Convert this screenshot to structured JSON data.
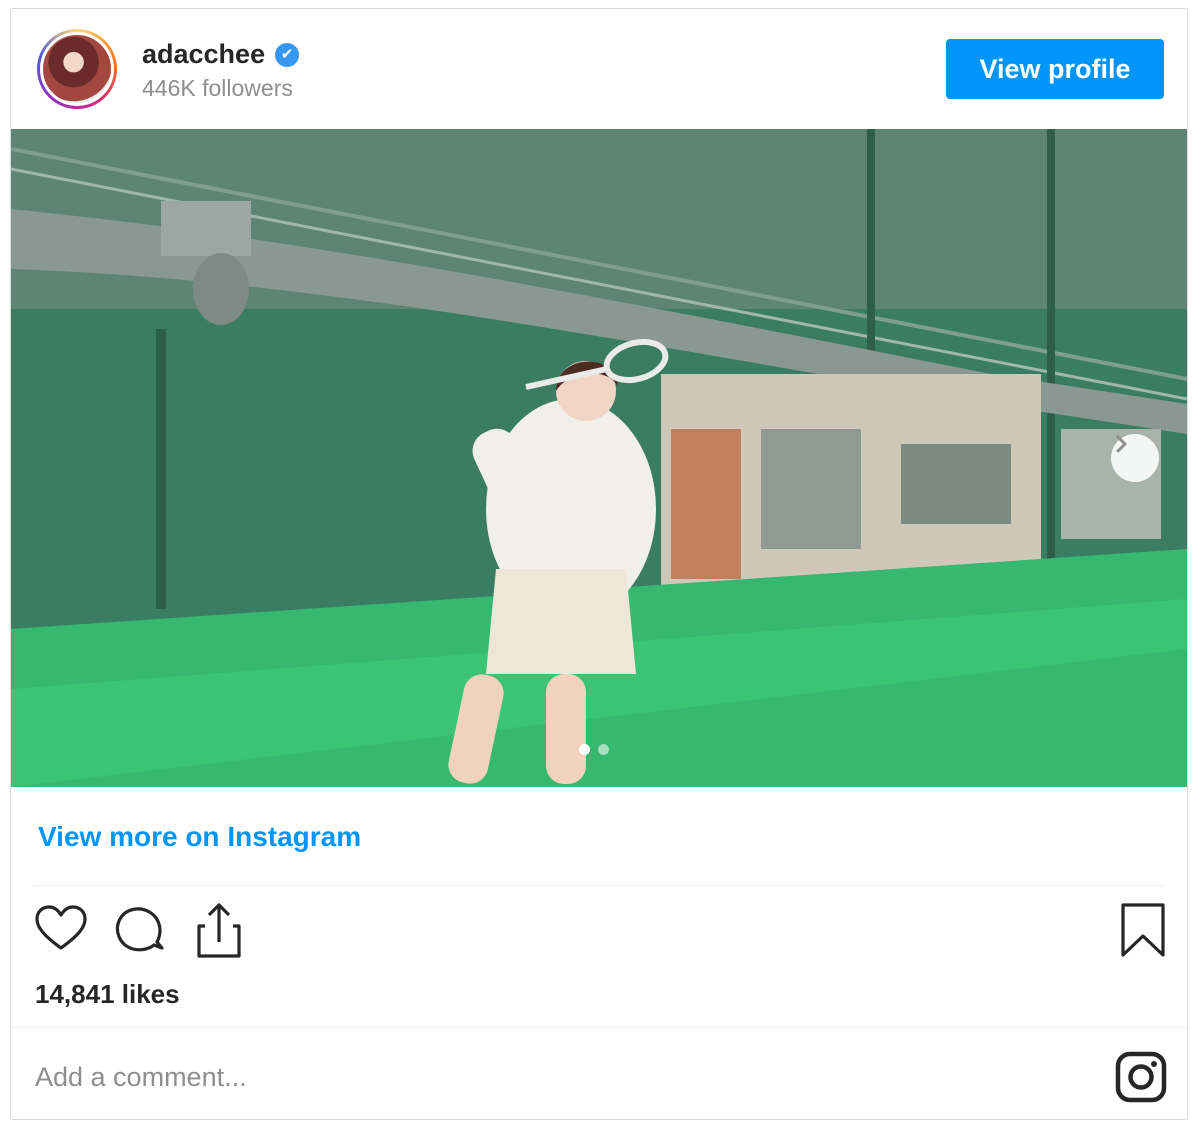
{
  "header": {
    "username": "adacchee",
    "verified_mark": "✔",
    "followers": "446K followers",
    "view_profile_label": "View profile"
  },
  "media": {
    "slide_count": 2,
    "active_slide": 1,
    "next_icon": "chevron-right-icon"
  },
  "footer": {
    "view_more_label": "View more on Instagram",
    "likes": "14,841 likes",
    "comment_placeholder": "Add a comment...",
    "action_icons": [
      "heart-icon",
      "comment-icon",
      "share-icon",
      "bookmark-icon"
    ],
    "brand_icon": "instagram-icon"
  },
  "colors": {
    "accent": "#0095f6",
    "verified": "#3897f0",
    "muted_text": "#8e8e8e",
    "border": "#dbdbdb"
  }
}
